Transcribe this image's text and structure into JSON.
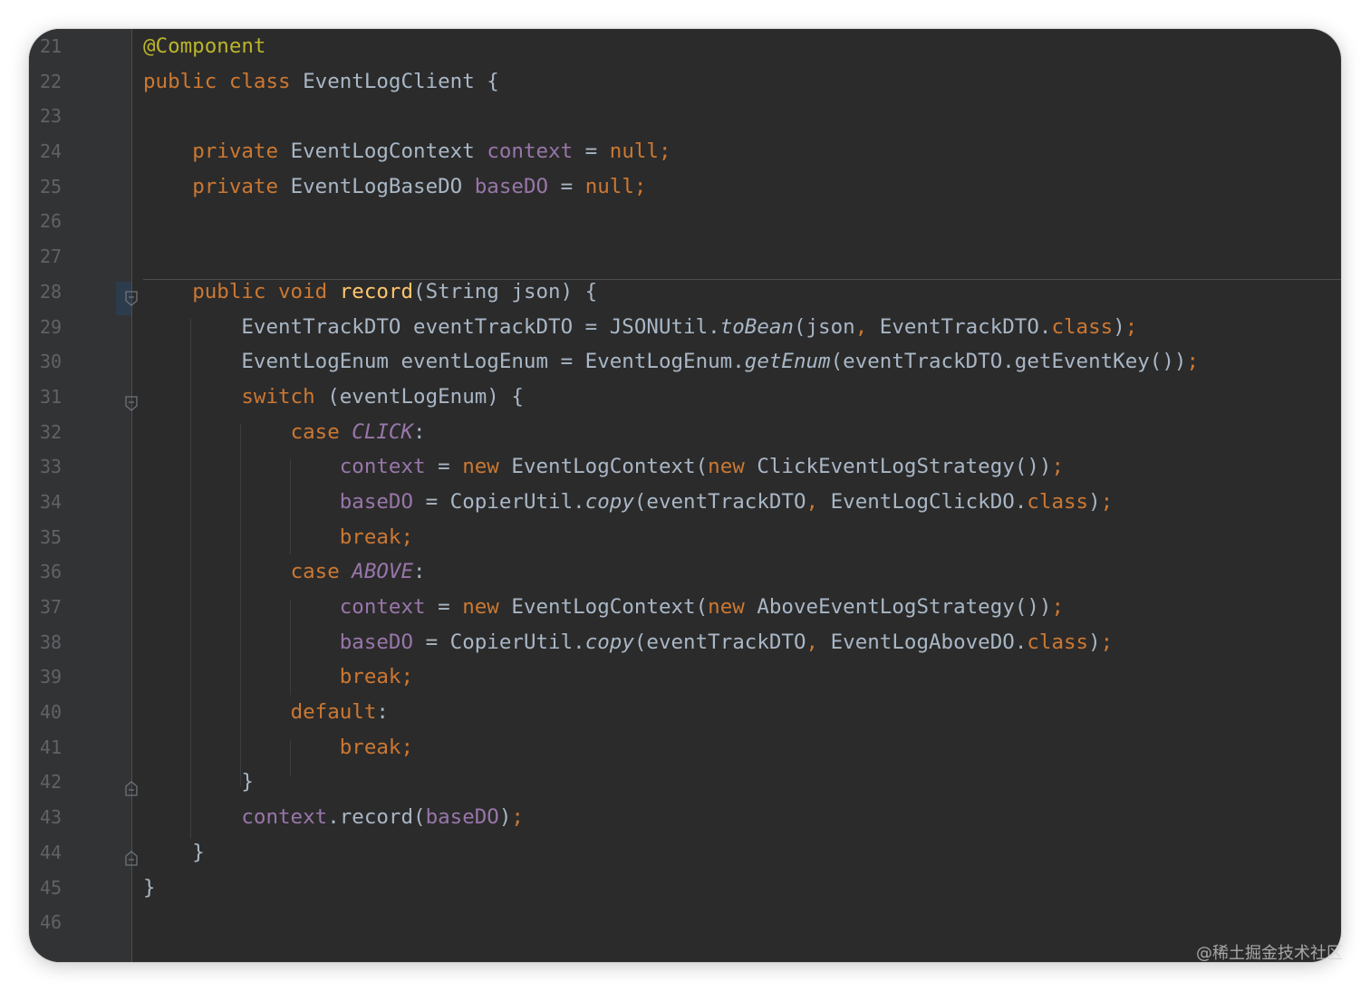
{
  "editor": {
    "theme_colors": {
      "background": "#2b2b2b",
      "gutter": "#313335",
      "keyword": "#cc7832",
      "annotation": "#bbb529",
      "field": "#9876aa",
      "method_decl": "#ffc66d",
      "default_text": "#a9b7c6",
      "line_number": "#606366"
    },
    "line_numbers": [
      "21",
      "22",
      "23",
      "24",
      "25",
      "26",
      "27",
      "28",
      "29",
      "30",
      "31",
      "32",
      "33",
      "34",
      "35",
      "36",
      "37",
      "38",
      "39",
      "40",
      "41",
      "42",
      "43",
      "44",
      "45",
      "46"
    ],
    "lines": [
      {
        "indent": "",
        "tokens": [
          {
            "t": "@Component",
            "c": "ann"
          }
        ]
      },
      {
        "indent": "",
        "tokens": [
          {
            "t": "public ",
            "c": "kw"
          },
          {
            "t": "class ",
            "c": "kw"
          },
          {
            "t": "EventLogClient {",
            "c": ""
          }
        ]
      },
      {
        "indent": "",
        "tokens": []
      },
      {
        "indent": "    ",
        "tokens": [
          {
            "t": "private ",
            "c": "kw"
          },
          {
            "t": "EventLogContext ",
            "c": ""
          },
          {
            "t": "context",
            "c": "field"
          },
          {
            "t": " = ",
            "c": ""
          },
          {
            "t": "null;",
            "c": "kw"
          }
        ]
      },
      {
        "indent": "    ",
        "tokens": [
          {
            "t": "private ",
            "c": "kw"
          },
          {
            "t": "EventLogBaseDO ",
            "c": ""
          },
          {
            "t": "baseDO",
            "c": "field"
          },
          {
            "t": " = ",
            "c": ""
          },
          {
            "t": "null;",
            "c": "kw"
          }
        ]
      },
      {
        "indent": "",
        "tokens": []
      },
      {
        "indent": "",
        "tokens": []
      },
      {
        "indent": "    ",
        "tokens": [
          {
            "t": "public ",
            "c": "kw"
          },
          {
            "t": "void ",
            "c": "kw"
          },
          {
            "t": "record",
            "c": "fn"
          },
          {
            "t": "(String json) {",
            "c": ""
          }
        ]
      },
      {
        "indent": "        ",
        "tokens": [
          {
            "t": "EventTrackDTO eventTrackDTO = JSONUtil.",
            "c": ""
          },
          {
            "t": "toBean",
            "c": "italic"
          },
          {
            "t": "(json",
            "c": ""
          },
          {
            "t": ", ",
            "c": "kw"
          },
          {
            "t": "EventTrackDTO.",
            "c": ""
          },
          {
            "t": "class",
            "c": "kw"
          },
          {
            "t": ")",
            "c": ""
          },
          {
            "t": ";",
            "c": "kw"
          }
        ]
      },
      {
        "indent": "        ",
        "tokens": [
          {
            "t": "EventLogEnum eventLogEnum = EventLogEnum.",
            "c": ""
          },
          {
            "t": "getEnum",
            "c": "italic"
          },
          {
            "t": "(eventTrackDTO.getEventKey())",
            "c": ""
          },
          {
            "t": ";",
            "c": "kw"
          }
        ]
      },
      {
        "indent": "        ",
        "tokens": [
          {
            "t": "switch ",
            "c": "kw"
          },
          {
            "t": "(eventLogEnum) {",
            "c": ""
          }
        ]
      },
      {
        "indent": "            ",
        "tokens": [
          {
            "t": "case ",
            "c": "kw"
          },
          {
            "t": "CLICK",
            "c": "static"
          },
          {
            "t": ":",
            "c": ""
          }
        ]
      },
      {
        "indent": "                ",
        "tokens": [
          {
            "t": "context",
            "c": "field"
          },
          {
            "t": " = ",
            "c": ""
          },
          {
            "t": "new ",
            "c": "kw"
          },
          {
            "t": "EventLogContext(",
            "c": ""
          },
          {
            "t": "new ",
            "c": "kw"
          },
          {
            "t": "ClickEventLogStrategy())",
            "c": ""
          },
          {
            "t": ";",
            "c": "kw"
          }
        ]
      },
      {
        "indent": "                ",
        "tokens": [
          {
            "t": "baseDO",
            "c": "field"
          },
          {
            "t": " = CopierUtil.",
            "c": ""
          },
          {
            "t": "copy",
            "c": "italic"
          },
          {
            "t": "(eventTrackDTO",
            "c": ""
          },
          {
            "t": ", ",
            "c": "kw"
          },
          {
            "t": "EventLogClickDO.",
            "c": ""
          },
          {
            "t": "class",
            "c": "kw"
          },
          {
            "t": ")",
            "c": ""
          },
          {
            "t": ";",
            "c": "kw"
          }
        ]
      },
      {
        "indent": "                ",
        "tokens": [
          {
            "t": "break;",
            "c": "kw"
          }
        ]
      },
      {
        "indent": "            ",
        "tokens": [
          {
            "t": "case ",
            "c": "kw"
          },
          {
            "t": "ABOVE",
            "c": "static"
          },
          {
            "t": ":",
            "c": ""
          }
        ]
      },
      {
        "indent": "                ",
        "tokens": [
          {
            "t": "context",
            "c": "field"
          },
          {
            "t": " = ",
            "c": ""
          },
          {
            "t": "new ",
            "c": "kw"
          },
          {
            "t": "EventLogContext(",
            "c": ""
          },
          {
            "t": "new ",
            "c": "kw"
          },
          {
            "t": "AboveEventLogStrategy())",
            "c": ""
          },
          {
            "t": ";",
            "c": "kw"
          }
        ]
      },
      {
        "indent": "                ",
        "tokens": [
          {
            "t": "baseDO",
            "c": "field"
          },
          {
            "t": " = CopierUtil.",
            "c": ""
          },
          {
            "t": "copy",
            "c": "italic"
          },
          {
            "t": "(eventTrackDTO",
            "c": ""
          },
          {
            "t": ", ",
            "c": "kw"
          },
          {
            "t": "EventLogAboveDO.",
            "c": ""
          },
          {
            "t": "class",
            "c": "kw"
          },
          {
            "t": ")",
            "c": ""
          },
          {
            "t": ";",
            "c": "kw"
          }
        ]
      },
      {
        "indent": "                ",
        "tokens": [
          {
            "t": "break;",
            "c": "kw"
          }
        ]
      },
      {
        "indent": "            ",
        "tokens": [
          {
            "t": "default",
            "c": "kw"
          },
          {
            "t": ":",
            "c": ""
          }
        ]
      },
      {
        "indent": "                ",
        "tokens": [
          {
            "t": "break;",
            "c": "kw"
          }
        ]
      },
      {
        "indent": "        ",
        "tokens": [
          {
            "t": "}",
            "c": ""
          }
        ]
      },
      {
        "indent": "        ",
        "tokens": [
          {
            "t": "context",
            "c": "field"
          },
          {
            "t": ".record(",
            "c": ""
          },
          {
            "t": "baseDO",
            "c": "field"
          },
          {
            "t": ")",
            "c": ""
          },
          {
            "t": ";",
            "c": "kw"
          }
        ]
      },
      {
        "indent": "    ",
        "tokens": [
          {
            "t": "}",
            "c": ""
          }
        ]
      },
      {
        "indent": "",
        "tokens": [
          {
            "t": "}",
            "c": ""
          }
        ]
      },
      {
        "indent": "",
        "tokens": []
      }
    ]
  },
  "watermark": "@稀土掘金技术社区"
}
